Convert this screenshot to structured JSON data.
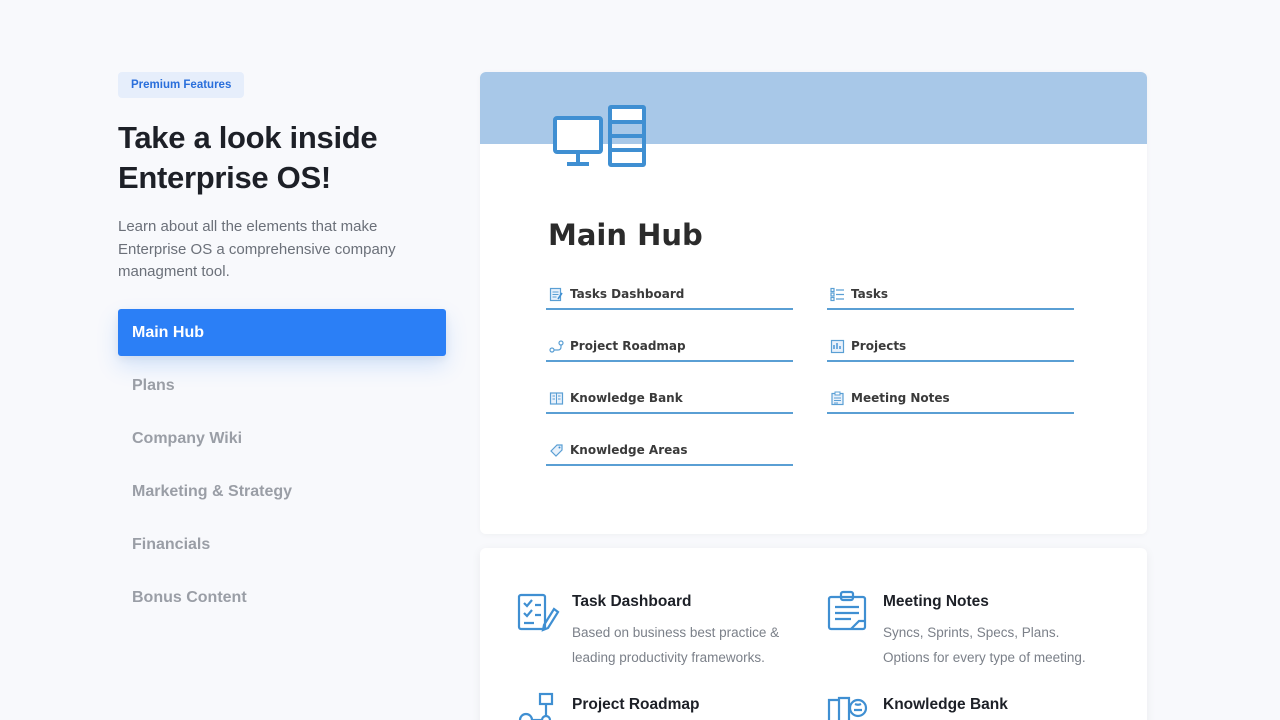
{
  "badge": "Premium Features",
  "headline_line1": "Take a look inside",
  "headline_line2": "Enterprise OS!",
  "description": "Learn about all the elements that make Enterprise OS a comprehensive company managment tool.",
  "nav": [
    {
      "label": "Main Hub",
      "active": true
    },
    {
      "label": "Plans"
    },
    {
      "label": "Company Wiki"
    },
    {
      "label": "Marketing & Strategy"
    },
    {
      "label": "Financials"
    },
    {
      "label": "Bonus Content"
    }
  ],
  "preview": {
    "cover_color": "#a8c8e8",
    "title": "Main Hub",
    "links": [
      {
        "label": "Tasks Dashboard",
        "icon": "tasks-dashboard-icon"
      },
      {
        "label": "Tasks",
        "icon": "list-icon"
      },
      {
        "label": "Project Roadmap",
        "icon": "roadmap-icon"
      },
      {
        "label": "Projects",
        "icon": "projects-icon"
      },
      {
        "label": "Knowledge Bank",
        "icon": "book-icon"
      },
      {
        "label": "Meeting Notes",
        "icon": "notes-icon"
      },
      {
        "label": "Knowledge Areas",
        "icon": "tag-icon"
      }
    ]
  },
  "features": [
    {
      "title": "Task Dashboard",
      "desc_line1": "Based on business best practice &",
      "desc_line2": "leading productivity frameworks.",
      "icon": "checklist-pencil-icon"
    },
    {
      "title": "Meeting Notes",
      "desc_line1": "Syncs, Sprints, Specs, Plans.",
      "desc_line2": "Options for every type of meeting.",
      "icon": "clipboard-notes-icon"
    },
    {
      "title": "Project Roadmap",
      "icon": "flowchart-icon"
    },
    {
      "title": "Knowledge Bank",
      "icon": "books-brain-icon"
    }
  ],
  "colors": {
    "accent": "#2b7ff6",
    "badge_bg": "#e6eefb",
    "icon_blue": "#3f8fd2",
    "link_underline": "#5a9fd4"
  }
}
